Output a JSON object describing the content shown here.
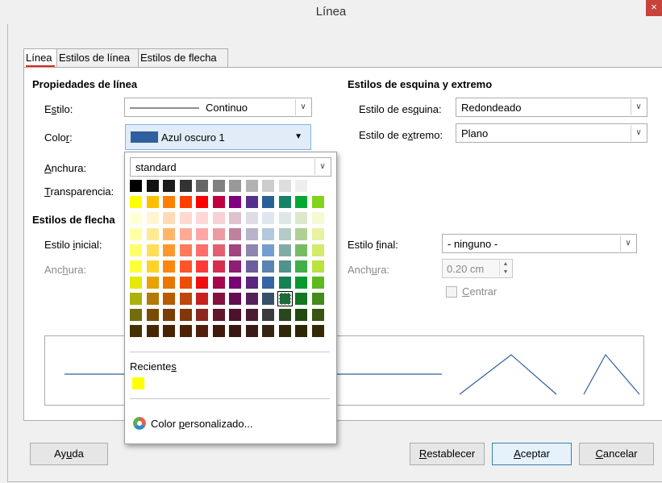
{
  "window": {
    "title": "Línea",
    "close_glyph": "×"
  },
  "tabs": [
    {
      "label": "Línea",
      "active": true
    },
    {
      "label": "Estilos de línea",
      "active": false
    },
    {
      "label": "Estilos de flecha",
      "active": false
    }
  ],
  "line_props": {
    "header": "Propiedades de línea",
    "style_label_pre": "E",
    "style_label_u": "s",
    "style_label_post": "tilo:",
    "style_value": "Continuo",
    "color_label_pre": "Colo",
    "color_label_u": "r",
    "color_label_post": ":",
    "color_value": "Azul oscuro 1",
    "color_swatch": "#2f5f9e",
    "width_label_pre": "",
    "width_label_u": "A",
    "width_label_post": "nchura:",
    "transp_label_pre": "",
    "transp_label_u": "T",
    "transp_label_post": "ransparencia:"
  },
  "corner": {
    "header": "Estilos de esquina y extremo",
    "corner_label_pre": "Estilo de es",
    "corner_label_u": "q",
    "corner_label_post": "uina:",
    "corner_value": "Redondeado",
    "cap_label_pre": "Estilo de e",
    "cap_label_u": "x",
    "cap_label_post": "tremo:",
    "cap_value": "Plano"
  },
  "arrows": {
    "header": "Estilos de flecha",
    "start_label_pre": "Estilo ",
    "start_label_u": "i",
    "start_label_post": "nicial:",
    "start_width_label_pre": "Anc",
    "start_width_label_u": "h",
    "start_width_label_post": "ura:",
    "end_label_pre": "Estilo ",
    "end_label_u": "f",
    "end_label_post": "inal:",
    "end_value": "- ninguno -",
    "end_width_label_pre": "Anch",
    "end_width_label_u": "u",
    "end_width_label_post": "ra:",
    "end_width_value": "0.20 cm",
    "center_label_pre": "",
    "center_label_u": "C",
    "center_label_post": "entrar"
  },
  "palette_popup": {
    "palette_name": "standard",
    "recent_label_pre": "Reciente",
    "recent_label_u": "s",
    "recent_label_post": "",
    "recent_colors": [
      "#ffff00"
    ],
    "custom_label_pre": "Color ",
    "custom_label_u": "p",
    "custom_label_post": "ersonalizado...",
    "selected": {
      "row": 7,
      "col": 9
    },
    "rows": [
      [
        "#000000",
        "#111111",
        "#1c1c1c",
        "#333333",
        "#666666",
        "#808080",
        "#999999",
        "#b2b2b2",
        "#cccccc",
        "#dddddd",
        "#eeeeee",
        "#ffffff"
      ],
      [
        "#ffff00",
        "#ffbf00",
        "#ff8000",
        "#ff4000",
        "#ff0000",
        "#bf0041",
        "#800080",
        "#55308d",
        "#2a6099",
        "#158466",
        "#00a933",
        "#81d41a"
      ],
      [
        "#ffffd7",
        "#fff5ce",
        "#ffdbb6",
        "#ffd8ce",
        "#ffd7d7",
        "#f7d1d5",
        "#e0c2cd",
        "#dedce6",
        "#dee6ef",
        "#dee7e5",
        "#dde8cb",
        "#f6f9d4"
      ],
      [
        "#ffffa6",
        "#ffe994",
        "#ffb66c",
        "#ffaa95",
        "#ffa6a6",
        "#ec9ba4",
        "#bf819e",
        "#b7b3ca",
        "#b4c7dc",
        "#b3cac7",
        "#afd095",
        "#e8f2a1"
      ],
      [
        "#ffff6d",
        "#ffde59",
        "#ff972f",
        "#ff7b59",
        "#ff6d6d",
        "#e16173",
        "#a1467e",
        "#8e86ae",
        "#729fcf",
        "#81aca6",
        "#77bc65",
        "#d4ea6b"
      ],
      [
        "#ffff38",
        "#ffd428",
        "#ff860d",
        "#ff5429",
        "#ff3838",
        "#d62e4e",
        "#8d1d75",
        "#6b5e9b",
        "#5983b0",
        "#50938a",
        "#3faf46",
        "#bbe33d"
      ],
      [
        "#e6e905",
        "#e8a202",
        "#ea7500",
        "#ed4c05",
        "#f10d0c",
        "#a7074b",
        "#780373",
        "#5b277d",
        "#3465a4",
        "#168253",
        "#069a2e",
        "#5eb91e"
      ],
      [
        "#acb20c",
        "#b47804",
        "#b85c00",
        "#be480a",
        "#c9211e",
        "#861141",
        "#650953",
        "#55215b",
        "#355269",
        "#1e6a39",
        "#127622",
        "#468a1a"
      ],
      [
        "#706e0c",
        "#784b04",
        "#7b3d00",
        "#813709",
        "#8d281e",
        "#611729",
        "#4e102d",
        "#481d32",
        "#383d3c",
        "#28471f",
        "#224b12",
        "#395511"
      ],
      [
        "#443205",
        "#472702",
        "#492300",
        "#4b2204",
        "#50200c",
        "#41190d",
        "#3b160e",
        "#3a1a14",
        "#362413",
        "#302709",
        "#2e2706",
        "#342a06"
      ]
    ]
  },
  "buttons": {
    "help_pre": "Ay",
    "help_u": "u",
    "help_post": "da",
    "reset_pre": "",
    "reset_u": "R",
    "reset_post": "establecer",
    "ok_pre": "",
    "ok_u": "A",
    "ok_post": "ceptar",
    "cancel_pre": "",
    "cancel_u": "C",
    "cancel_post": "ancelar"
  }
}
